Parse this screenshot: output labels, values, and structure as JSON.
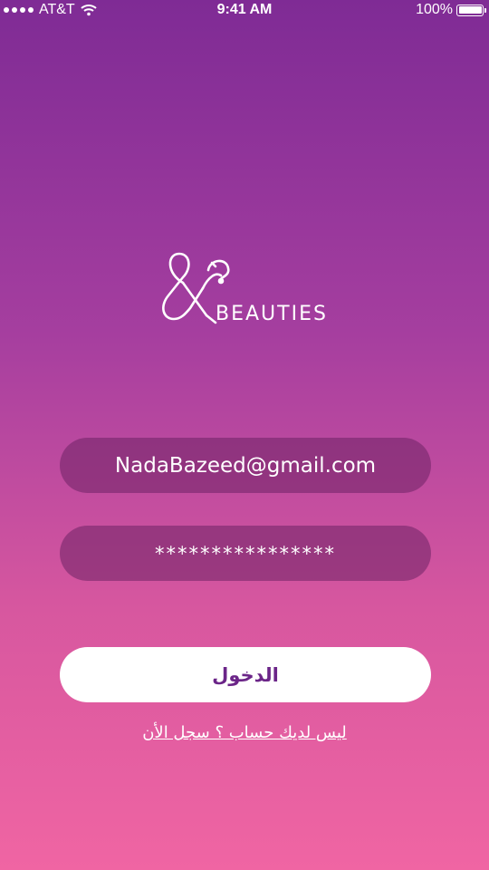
{
  "status_bar": {
    "carrier": "AT&T",
    "time": "9:41 AM",
    "battery": "100%"
  },
  "logo": {
    "brand": "BEAUTIES"
  },
  "login_form": {
    "email_value": "NadaBazeed@gmail.com",
    "password_value": "****************",
    "submit_label": "الدخول",
    "register_link": "ليس لديك حساب ؟ سجل الأن"
  },
  "colors": {
    "gradient_top": "#7f2b95",
    "gradient_bottom": "#f065a3",
    "button_text": "#6b2588"
  }
}
